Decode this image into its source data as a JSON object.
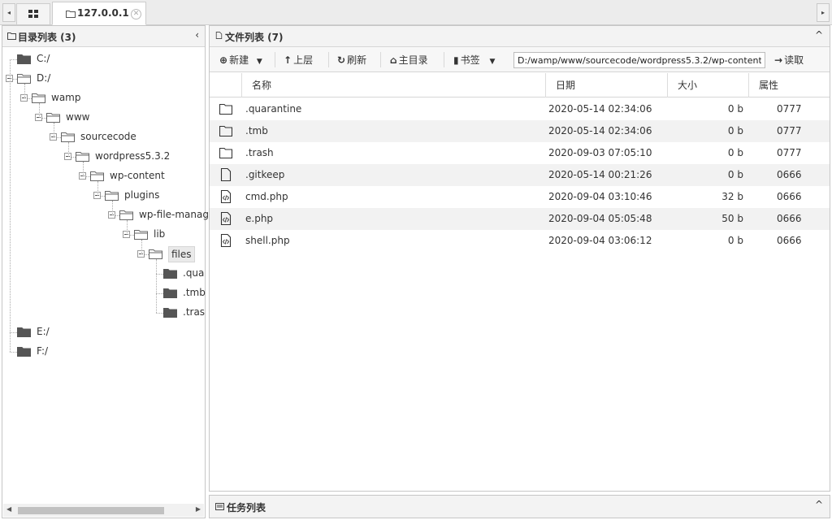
{
  "tabs": {
    "active_label": "127.0.0.1",
    "left_arrow": "◂",
    "right_arrow": "▸",
    "close": "✕"
  },
  "directory_panel": {
    "title": "目录列表 (3)",
    "collapse": "‹",
    "tree": [
      {
        "label": "C:/",
        "depth": 0,
        "type": "closed"
      },
      {
        "label": "D:/",
        "depth": 0,
        "type": "open"
      },
      {
        "label": "wamp",
        "depth": 1,
        "type": "open"
      },
      {
        "label": "www",
        "depth": 2,
        "type": "open"
      },
      {
        "label": "sourcecode",
        "depth": 3,
        "type": "open"
      },
      {
        "label": "wordpress5.3.2",
        "depth": 4,
        "type": "open"
      },
      {
        "label": "wp-content",
        "depth": 5,
        "type": "open"
      },
      {
        "label": "plugins",
        "depth": 6,
        "type": "open"
      },
      {
        "label": "wp-file-manag",
        "depth": 7,
        "type": "open"
      },
      {
        "label": "lib",
        "depth": 8,
        "type": "open"
      },
      {
        "label": "files",
        "depth": 9,
        "type": "open",
        "selected": true
      },
      {
        "label": ".qua",
        "depth": 10,
        "type": "closed"
      },
      {
        "label": ".tmb",
        "depth": 10,
        "type": "closed"
      },
      {
        "label": ".tras",
        "depth": 10,
        "type": "closed"
      },
      {
        "label": "E:/",
        "depth": 0,
        "type": "closed"
      },
      {
        "label": "F:/",
        "depth": 0,
        "type": "closed"
      }
    ]
  },
  "file_panel": {
    "title": "文件列表 (7)",
    "collapse": "^",
    "toolbar": {
      "new": "新建",
      "up": "上层",
      "refresh": "刷新",
      "home": "主目录",
      "bookmark": "书签",
      "path": "D:/wamp/www/sourcecode/wordpress5.3.2/wp-content/",
      "read": "读取"
    },
    "columns": {
      "name": "名称",
      "date": "日期",
      "size": "大小",
      "attr": "属性"
    },
    "rows": [
      {
        "icon": "folder-icon",
        "name": ".quarantine",
        "date": "2020-05-14 02:34:06",
        "size": "0 b",
        "attr": "0777"
      },
      {
        "icon": "folder-icon",
        "name": ".tmb",
        "date": "2020-05-14 02:34:06",
        "size": "0 b",
        "attr": "0777"
      },
      {
        "icon": "folder-icon",
        "name": ".trash",
        "date": "2020-09-03 07:05:10",
        "size": "0 b",
        "attr": "0777"
      },
      {
        "icon": "file-icon",
        "name": ".gitkeep",
        "date": "2020-05-14 00:21:26",
        "size": "0 b",
        "attr": "0666"
      },
      {
        "icon": "code-file-icon",
        "name": "cmd.php",
        "date": "2020-09-04 03:10:46",
        "size": "32 b",
        "attr": "0666"
      },
      {
        "icon": "code-file-icon",
        "name": "e.php",
        "date": "2020-09-04 05:05:48",
        "size": "50 b",
        "attr": "0666"
      },
      {
        "icon": "code-file-icon",
        "name": "shell.php",
        "date": "2020-09-04 03:06:12",
        "size": "0 b",
        "attr": "0666"
      }
    ]
  },
  "task_panel": {
    "title": "任务列表",
    "expand": "^"
  }
}
